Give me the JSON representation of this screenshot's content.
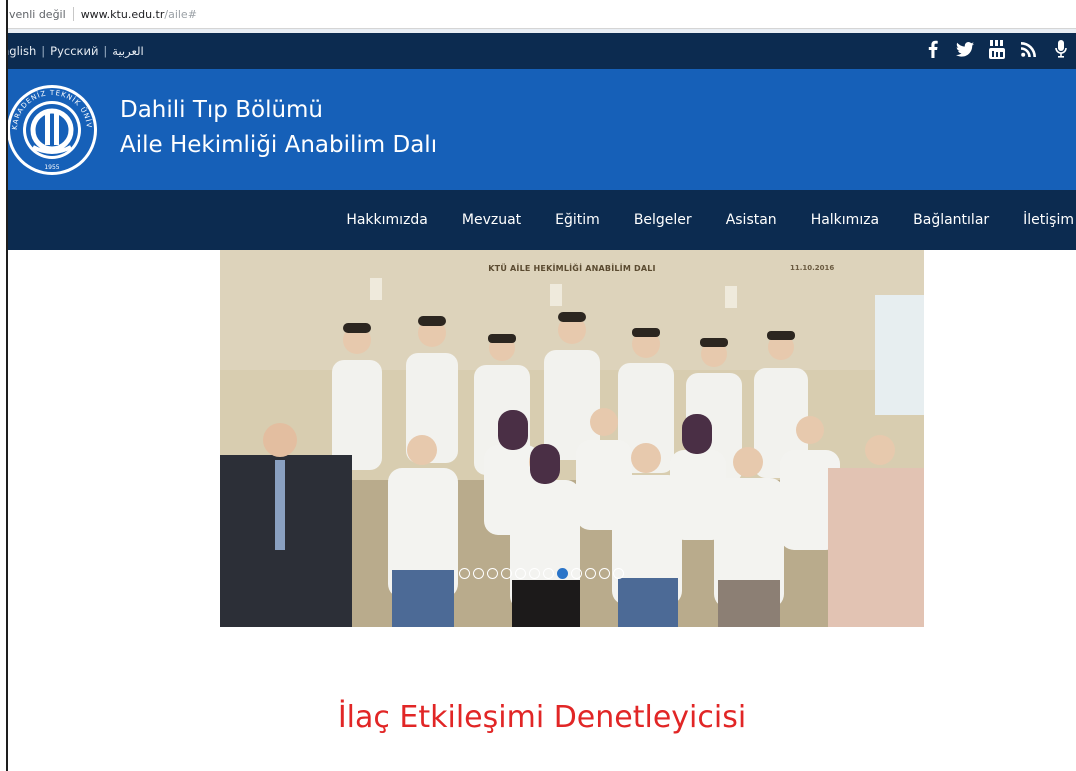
{
  "browser": {
    "security": "üvenli değil",
    "domain": "www.ktu.edu.tr",
    "path": "/aile#"
  },
  "languages": [
    "nglish",
    "Русский",
    "العربية"
  ],
  "social": [
    {
      "name": "facebook-icon",
      "glyph": "f"
    },
    {
      "name": "twitter-icon",
      "glyph": "🐦"
    },
    {
      "name": "youtube-icon",
      "glyph": "▶"
    },
    {
      "name": "rss-icon",
      "glyph": "◉"
    },
    {
      "name": "podcast-icon",
      "glyph": "🎙"
    }
  ],
  "header": {
    "title_line1": "Dahili Tıp Bölümü",
    "title_line2": "Aile Hekimliği Anabilim Dalı"
  },
  "nav": {
    "items": [
      "Hakkımızda",
      "Mevzuat",
      "Eğitim",
      "Belgeler",
      "Asistan",
      "Halkımıza",
      "Bağlantılar",
      "İletişim"
    ]
  },
  "slider": {
    "caption": "KTÜ AİLE HEKİMLİĞİ ANABİLİM DALI",
    "date": "11.10.2016",
    "slide_count": 12,
    "active_index": 7
  },
  "main": {
    "heading": "İlaç Etkileşimi Denetleyicisi"
  },
  "colors": {
    "nav_bg": "#0c2b50",
    "header_bg": "#1660b8",
    "heading": "#e12626",
    "active_dot": "#2a74c8"
  }
}
